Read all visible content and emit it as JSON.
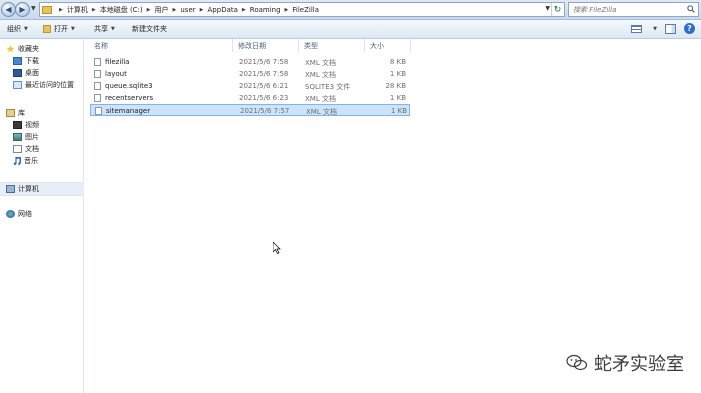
{
  "address": {
    "crumbs": [
      "计算机",
      "本地磁盘 (C:)",
      "用户",
      "user",
      "AppData",
      "Roaming",
      "FileZilla"
    ],
    "search_placeholder": "搜索 FileZilla"
  },
  "toolbar": {
    "organize_label": "组织",
    "open_label": "打开",
    "share_label": "共享",
    "new_folder_label": "新建文件夹"
  },
  "sidebar": {
    "favorites": {
      "label": "收藏夹",
      "items": [
        "下载",
        "桌面",
        "最近访问的位置"
      ]
    },
    "libraries": {
      "label": "库",
      "items": [
        "视频",
        "图片",
        "文档",
        "音乐"
      ]
    },
    "computer": {
      "label": "计算机"
    },
    "network": {
      "label": "网络"
    }
  },
  "filelist": {
    "columns": {
      "name": "名称",
      "date": "修改日期",
      "type": "类型",
      "size": "大小"
    },
    "rows": [
      {
        "name": "filezilla",
        "date": "2021/5/6 7:58",
        "type": "XML 文档",
        "size": "8 KB",
        "selected": false
      },
      {
        "name": "layout",
        "date": "2021/5/6 7:58",
        "type": "XML 文档",
        "size": "1 KB",
        "selected": false
      },
      {
        "name": "queue.sqlite3",
        "date": "2021/5/6 6:21",
        "type": "SQLITE3 文件",
        "size": "28 KB",
        "selected": false
      },
      {
        "name": "recentservers",
        "date": "2021/5/6 6:23",
        "type": "XML 文档",
        "size": "1 KB",
        "selected": false
      },
      {
        "name": "sitemanager",
        "date": "2021/5/6 7:57",
        "type": "XML 文档",
        "size": "1 KB",
        "selected": true
      }
    ]
  },
  "watermark": {
    "text": "蛇矛实验室"
  }
}
